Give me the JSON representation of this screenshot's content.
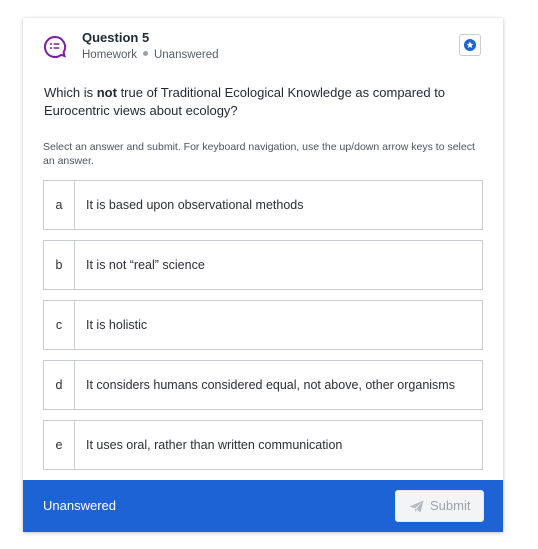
{
  "question": {
    "title": "Question 5",
    "category": "Homework",
    "status": "Unanswered",
    "prompt_before": "Which is ",
    "prompt_bold": "not",
    "prompt_after": " true of Traditional Ecological Knowledge as compared to Eurocentric views about ecology?",
    "instructions": "Select an answer and submit. For keyboard navigation, use the up/down arrow keys to select an answer.",
    "icon": "question-list-icon",
    "flag_icon": "star-badge-icon"
  },
  "choices": [
    {
      "letter": "a",
      "text": "It is based upon observational methods"
    },
    {
      "letter": "b",
      "text": "It is not “real” science"
    },
    {
      "letter": "c",
      "text": "It is holistic"
    },
    {
      "letter": "d",
      "text": "It considers humans considered equal, not above, other organisms"
    },
    {
      "letter": "e",
      "text": "It uses oral, rather than written communication"
    }
  ],
  "footer": {
    "status": "Unanswered",
    "submit_label": "Submit",
    "submit_icon": "send-icon"
  },
  "colors": {
    "accent": "#1e63d6",
    "icon_purple": "#7b1fa2"
  }
}
